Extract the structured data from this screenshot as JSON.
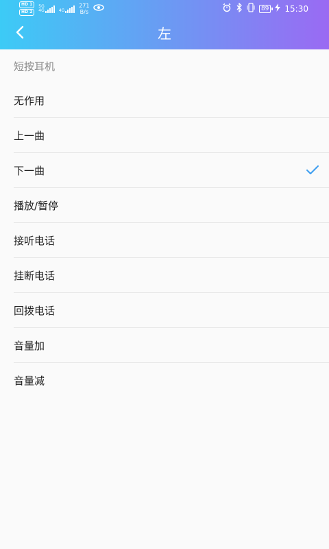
{
  "statusbar": {
    "hd1": "HD 1",
    "hd2": "HD 2",
    "net_top": "5G",
    "net_bottom": "4G",
    "net2": "4G",
    "speed_value": "271",
    "speed_unit": "B/s",
    "battery": "89",
    "time": "15:30"
  },
  "header": {
    "title": "左"
  },
  "section": {
    "label": "短按耳机"
  },
  "options": [
    {
      "label": "无作用"
    },
    {
      "label": "上一曲"
    },
    {
      "label": "下一曲",
      "selected": true
    },
    {
      "label": "播放/暂停"
    },
    {
      "label": "接听电话"
    },
    {
      "label": "挂断电话"
    },
    {
      "label": "回拨电话"
    },
    {
      "label": "音量加"
    },
    {
      "label": "音量减"
    }
  ],
  "colors": {
    "accent": "#3b9df0",
    "header_start": "#3ccbf6",
    "header_end": "#9a6af3"
  }
}
